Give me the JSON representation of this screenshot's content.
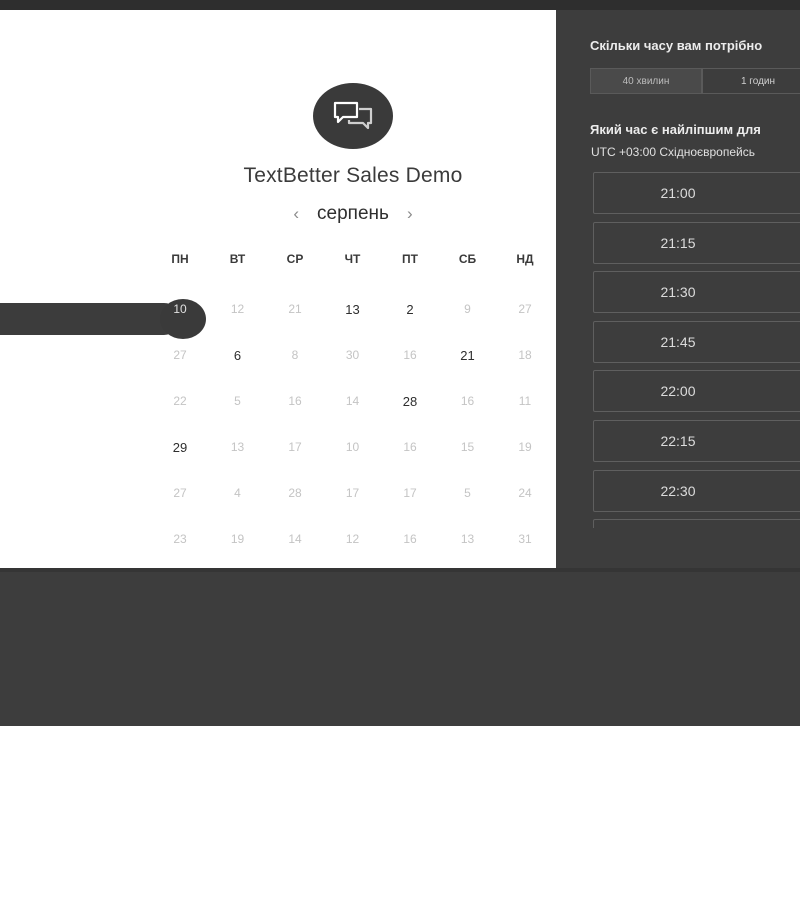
{
  "calendar": {
    "title": "TextBetter Sales Demo",
    "month": "серпень",
    "prev": "‹",
    "next": "›",
    "weekdays": [
      "ПН",
      "ВТ",
      "СР",
      "ЧТ",
      "ПТ",
      "СБ",
      "НД"
    ],
    "selected_day": "10",
    "rows": [
      [
        "10",
        "12",
        "21",
        "13",
        "2",
        "9",
        "27"
      ],
      [
        "27",
        "6",
        "8",
        "30",
        "16",
        "21",
        "18"
      ],
      [
        "22",
        "5",
        "16",
        "14",
        "28",
        "16",
        "11"
      ],
      [
        "29",
        "13",
        "17",
        "10",
        "16",
        "15",
        "19"
      ],
      [
        "27",
        "4",
        "28",
        "17",
        "17",
        "5",
        "24"
      ],
      [
        "23",
        "19",
        "14",
        "12",
        "16",
        "13",
        "31"
      ]
    ]
  },
  "booking": {
    "duration_question": "Скільки часу вам потрібно",
    "durations": [
      "40 хвилин",
      "1 годин"
    ],
    "time_question": "Який час є найліпшим для",
    "timezone": "UTC +03:00 Східноєвропейсь",
    "slots": [
      "21:00",
      "21:15",
      "21:30",
      "21:45",
      "22:00",
      "22:15",
      "22:30"
    ]
  }
}
